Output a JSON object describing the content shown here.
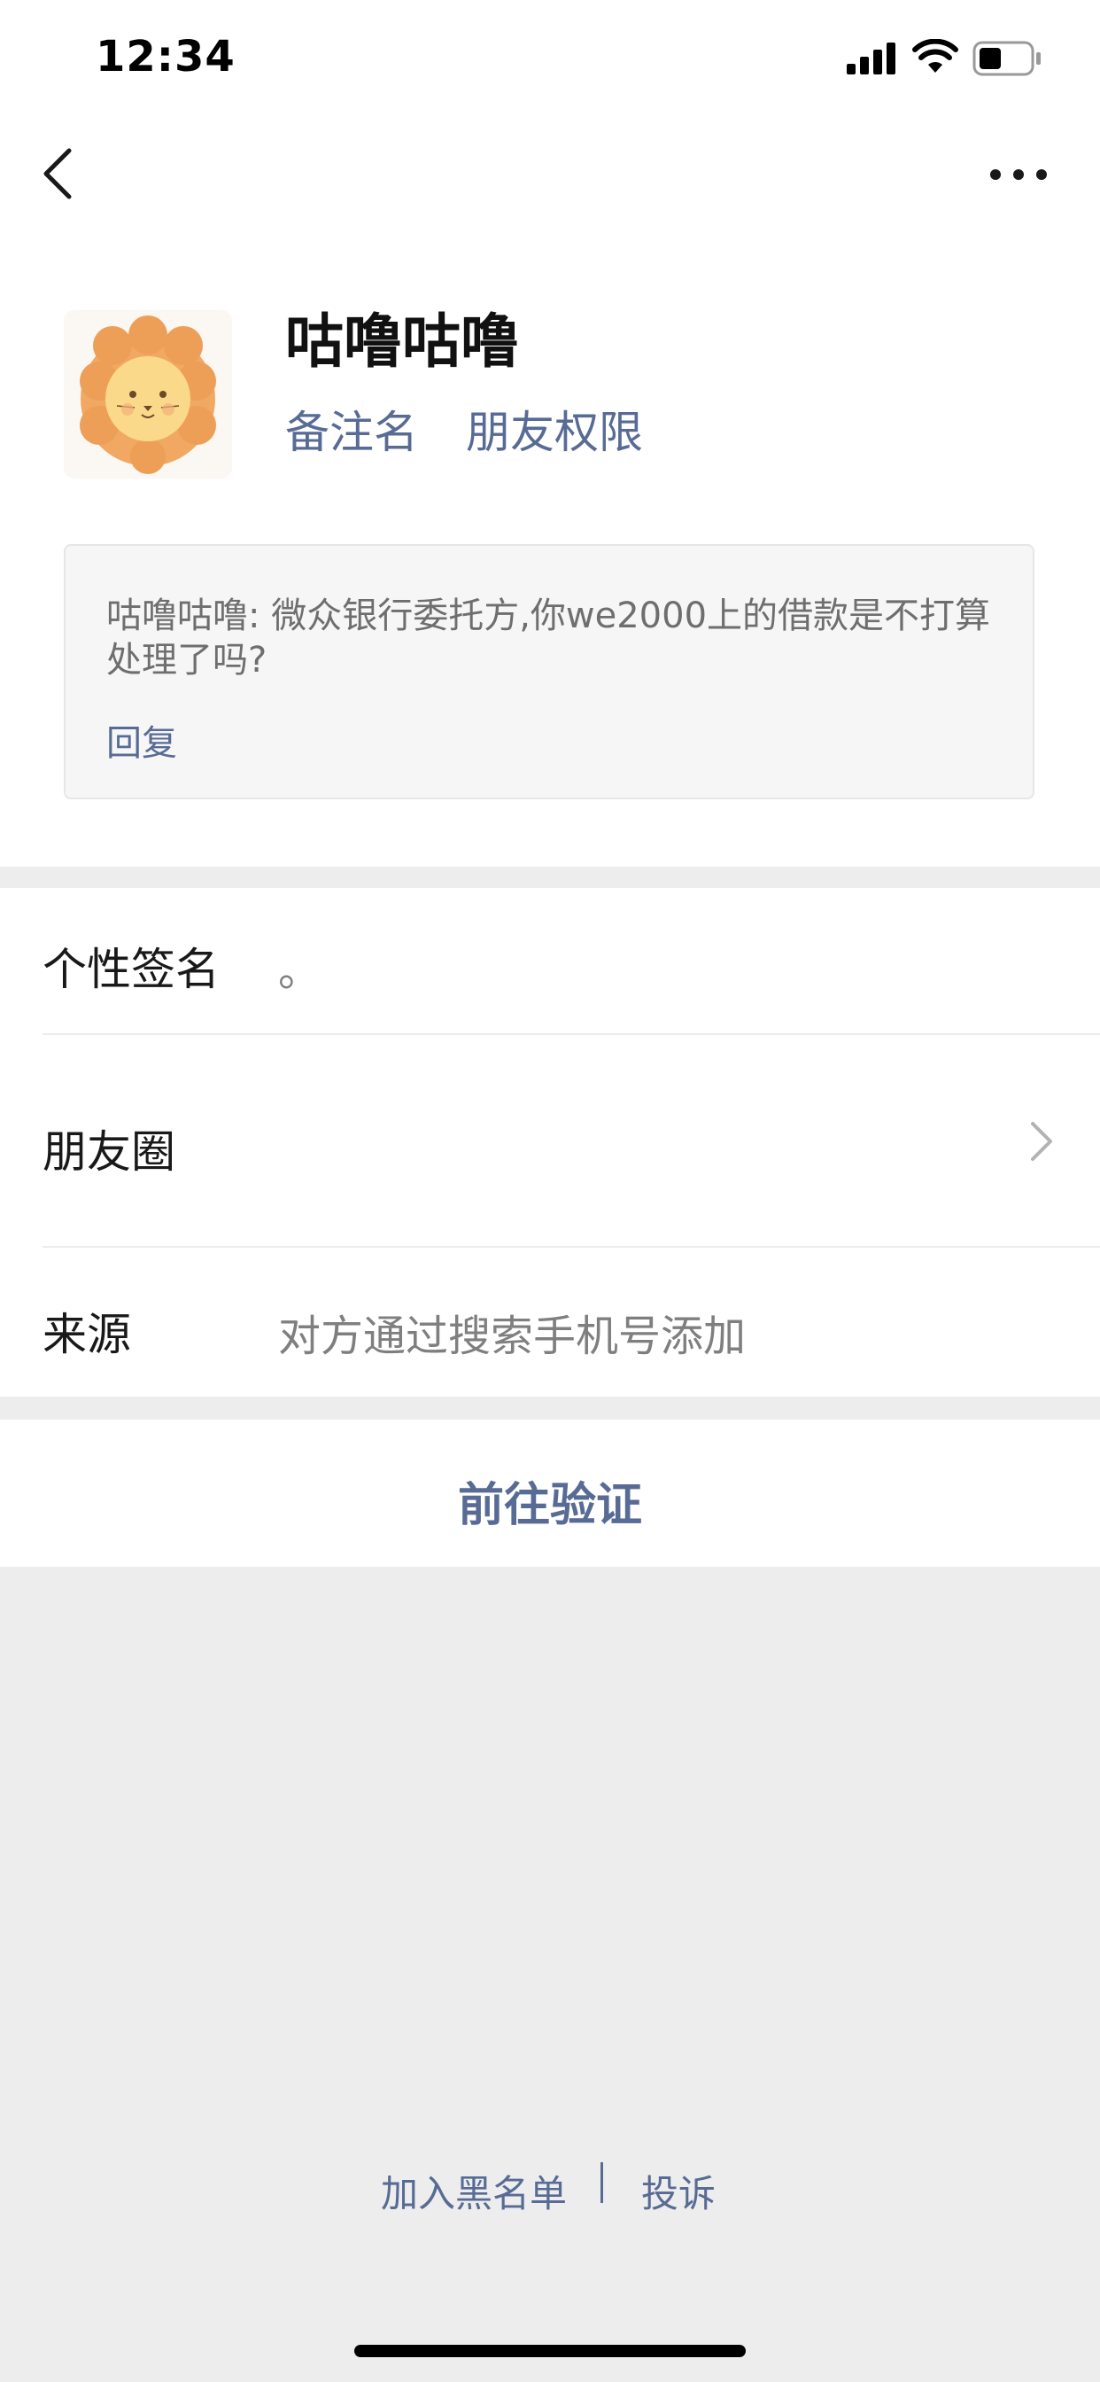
{
  "status_bar": {
    "time": "12:34",
    "battery_level": 0.45
  },
  "nav": {
    "back_icon": "chevron-left-icon",
    "more_icon": "more-dots-icon"
  },
  "profile": {
    "name": "咕噜咕噜",
    "remark_link": "备注名",
    "permission_link": "朋友权限",
    "avatar": "lion-avatar"
  },
  "message": {
    "text": "咕噜咕噜: 微众银行委托方,你we2000上的借款是不打算处理了吗?",
    "reply_label": "回复"
  },
  "info": {
    "signature_label": "个性签名",
    "signature_value": "。",
    "moments_label": "朋友圈",
    "source_label": "来源",
    "source_value": "对方通过搜索手机号添加"
  },
  "verify": {
    "label": "前往验证"
  },
  "footer": {
    "blacklist_label": "加入黑名单",
    "separator": "|",
    "report_label": "投诉"
  },
  "colors": {
    "link": "#576b95",
    "background": "#ededed",
    "panel": "#ffffff"
  }
}
